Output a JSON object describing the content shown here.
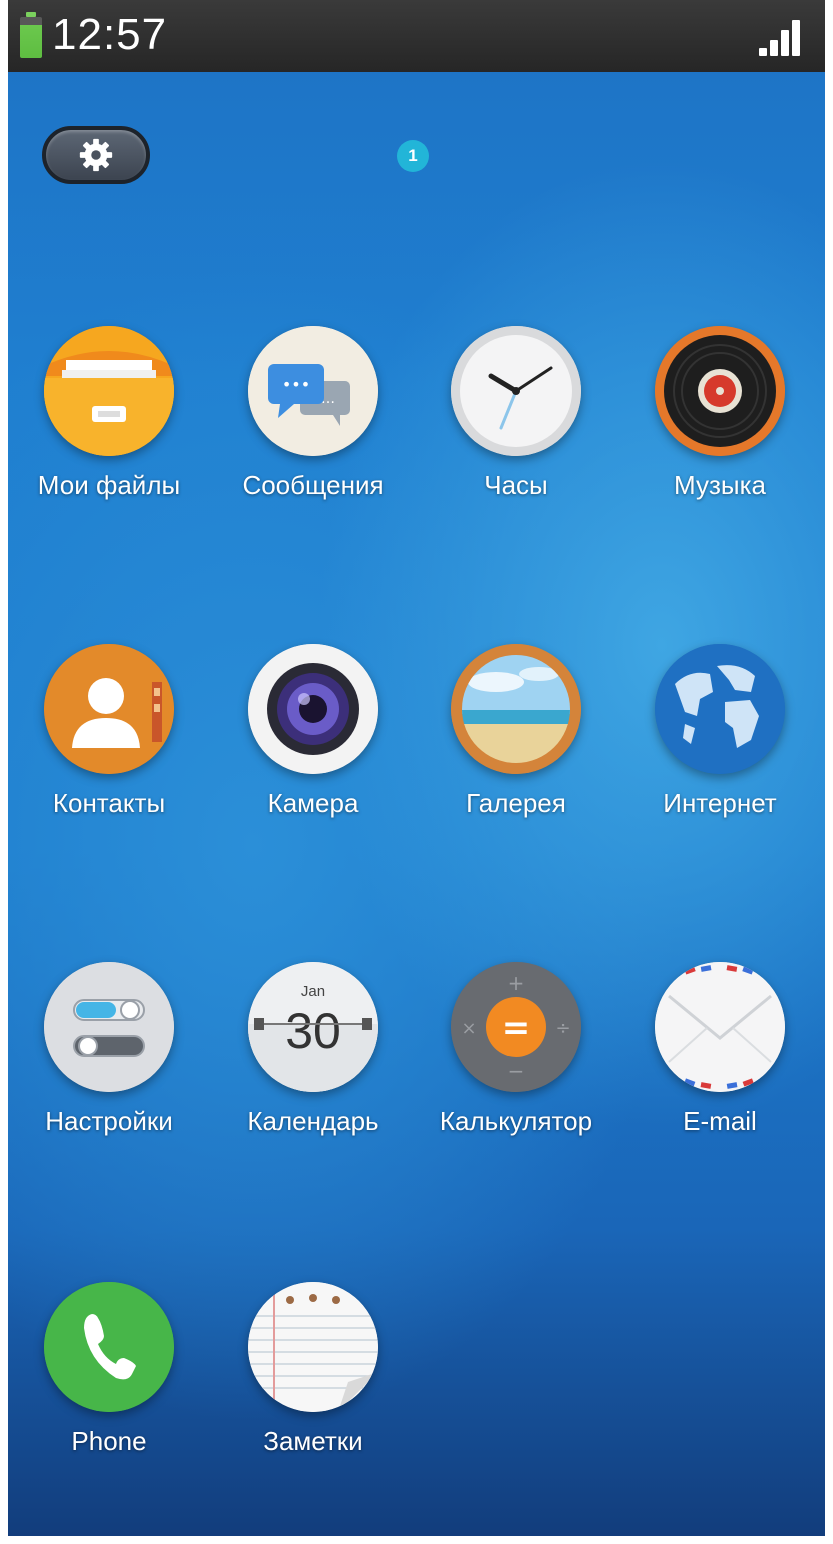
{
  "status_bar": {
    "time": "12:57",
    "icons": [
      "battery-icon",
      "signal-icon"
    ],
    "battery_color": "#6bc84d"
  },
  "home": {
    "page_indicator": "1",
    "settings_button_icon": "gear-icon",
    "accent_color": "#22b5d8"
  },
  "apps": [
    {
      "label": "Мои файлы",
      "icon": "folder-icon"
    },
    {
      "label": "Сообщения",
      "icon": "chat-icon"
    },
    {
      "label": "Часы",
      "icon": "clock-icon"
    },
    {
      "label": "Музыка",
      "icon": "vinyl-icon"
    },
    {
      "label": "Контакты",
      "icon": "contacts-icon"
    },
    {
      "label": "Камера",
      "icon": "camera-lens-icon"
    },
    {
      "label": "Галерея",
      "icon": "beach-photo-icon"
    },
    {
      "label": "Интернет",
      "icon": "globe-icon"
    },
    {
      "label": "Настройки",
      "icon": "toggles-icon"
    },
    {
      "label": "Календарь",
      "icon": "calendar-icon",
      "month": "Jan",
      "day": "30"
    },
    {
      "label": "Калькулятор",
      "icon": "calculator-icon",
      "symbols": [
        "+",
        "×",
        "=",
        "÷",
        "−"
      ]
    },
    {
      "label": "E-mail",
      "icon": "envelope-icon"
    },
    {
      "label": "Phone",
      "icon": "phone-icon"
    },
    {
      "label": "Заметки",
      "icon": "notepad-icon"
    }
  ]
}
